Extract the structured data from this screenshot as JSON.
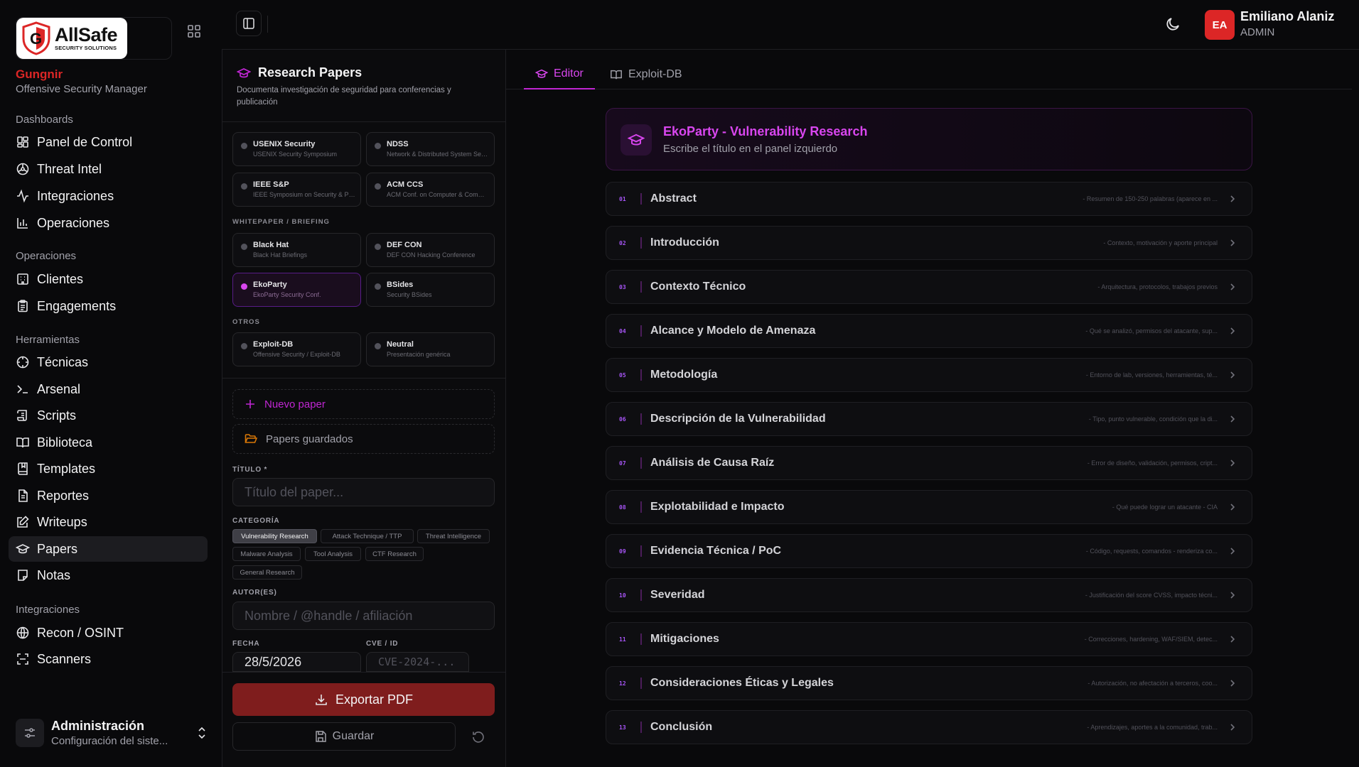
{
  "sidebar": {
    "logo_text": "AllSafe",
    "logo_sub": "SECURITY SOLUTIONS",
    "org_name": "Gungnir",
    "org_role": "Offensive Security Manager",
    "sections": {
      "dashboards": "Dashboards",
      "operaciones": "Operaciones",
      "herramientas": "Herramientas",
      "integraciones": "Integraciones"
    },
    "items": {
      "panel": "Panel de Control",
      "threat": "Threat Intel",
      "integraciones": "Integraciones",
      "operaciones": "Operaciones",
      "clientes": "Clientes",
      "engagements": "Engagements",
      "tecnicas": "Técnicas",
      "arsenal": "Arsenal",
      "scripts": "Scripts",
      "biblioteca": "Biblioteca",
      "templates": "Templates",
      "reportes": "Reportes",
      "writeups": "Writeups",
      "papers": "Papers",
      "notas": "Notas",
      "recon": "Recon / OSINT",
      "scanners": "Scanners"
    },
    "admin_title": "Administración",
    "admin_sub": "Configuración del siste..."
  },
  "topbar": {
    "avatar_initials": "EA",
    "user_name": "Emiliano Alaniz",
    "user_role": "ADMIN"
  },
  "panel": {
    "title": "Research Papers",
    "description": "Documenta investigación de seguridad para conferencias y publicación",
    "groups": {
      "whitepaper": "WHITEPAPER / BRIEFING",
      "otros": "OTROS"
    },
    "venues": {
      "usenix": {
        "name": "USENIX Security",
        "sub": "USENIX Security Symposium"
      },
      "ndss": {
        "name": "NDSS",
        "sub": "Network & Distributed System Sec..."
      },
      "ieee": {
        "name": "IEEE S&P",
        "sub": "IEEE Symposium on Security & Priv..."
      },
      "acm": {
        "name": "ACM CCS",
        "sub": "ACM Conf. on Computer & Commu..."
      },
      "blackhat": {
        "name": "Black Hat",
        "sub": "Black Hat Briefings"
      },
      "defcon": {
        "name": "DEF CON",
        "sub": "DEF CON Hacking Conference"
      },
      "ekoparty": {
        "name": "EkoParty",
        "sub": "EkoParty Security Conf."
      },
      "bsides": {
        "name": "BSides",
        "sub": "Security BSides"
      },
      "exploitdb": {
        "name": "Exploit-DB",
        "sub": "Offensive Security / Exploit-DB"
      },
      "neutral": {
        "name": "Neutral",
        "sub": "Presentación genérica"
      }
    },
    "new_paper": "Nuevo paper",
    "saved_papers": "Papers guardados",
    "title_label": "TÍTULO *",
    "title_placeholder": "Título del paper...",
    "category_label": "CATEGORÍA",
    "categories": [
      "Vulnerability Research",
      "Attack Technique / TTP",
      "Threat Intelligence",
      "Malware Analysis",
      "Tool Analysis",
      "CTF Research",
      "General Research"
    ],
    "author_label": "AUTOR(ES)",
    "author_placeholder": "Nombre / @handle / afiliación",
    "date_label": "FECHA",
    "date_value": "28/5/2026",
    "cve_label": "CVE / ID",
    "cve_placeholder": "CVE-2024-...",
    "export_label": "Exportar PDF",
    "save_label": "Guardar"
  },
  "editor": {
    "tabs": {
      "editor": "Editor",
      "exploit": "Exploit-DB"
    },
    "hero_title": "EkoParty - Vulnerability Research",
    "hero_sub": "Escribe el título en el panel izquierdo",
    "sections": [
      {
        "num": "01",
        "title": "Abstract",
        "hint": "- Resumen de 150-250 palabras (aparece en ..."
      },
      {
        "num": "02",
        "title": "Introducción",
        "hint": "- Contexto, motivación y aporte principal"
      },
      {
        "num": "03",
        "title": "Contexto Técnico",
        "hint": "- Arquitectura, protocolos, trabajos previos"
      },
      {
        "num": "04",
        "title": "Alcance y Modelo de Amenaza",
        "hint": "- Qué se analizó, permisos del atacante, sup..."
      },
      {
        "num": "05",
        "title": "Metodología",
        "hint": "- Entorno de lab, versiones, herramientas, té..."
      },
      {
        "num": "06",
        "title": "Descripción de la Vulnerabilidad",
        "hint": "- Tipo, punto vulnerable, condición que la di..."
      },
      {
        "num": "07",
        "title": "Análisis de Causa Raíz",
        "hint": "- Error de diseño, validación, permisos, cript..."
      },
      {
        "num": "08",
        "title": "Explotabilidad e Impacto",
        "hint": "- Qué puede lograr un atacante - CIA"
      },
      {
        "num": "09",
        "title": "Evidencia Técnica / PoC",
        "hint": "- Código, requests, comandos - renderiza co..."
      },
      {
        "num": "10",
        "title": "Severidad",
        "hint": "- Justificación del score CVSS, impacto técni..."
      },
      {
        "num": "11",
        "title": "Mitigaciones",
        "hint": "- Correcciones, hardening, WAF/SIEM, detec..."
      },
      {
        "num": "12",
        "title": "Consideraciones Éticas y Legales",
        "hint": "- Autorización, no afectación a terceros, coo..."
      },
      {
        "num": "13",
        "title": "Conclusión",
        "hint": "- Aprendizajes, aportes a la comunidad, trab..."
      }
    ]
  },
  "colors": {
    "accent": "#d946ef",
    "brand_red": "#dc2626",
    "export_bg": "#7f1d1d"
  }
}
